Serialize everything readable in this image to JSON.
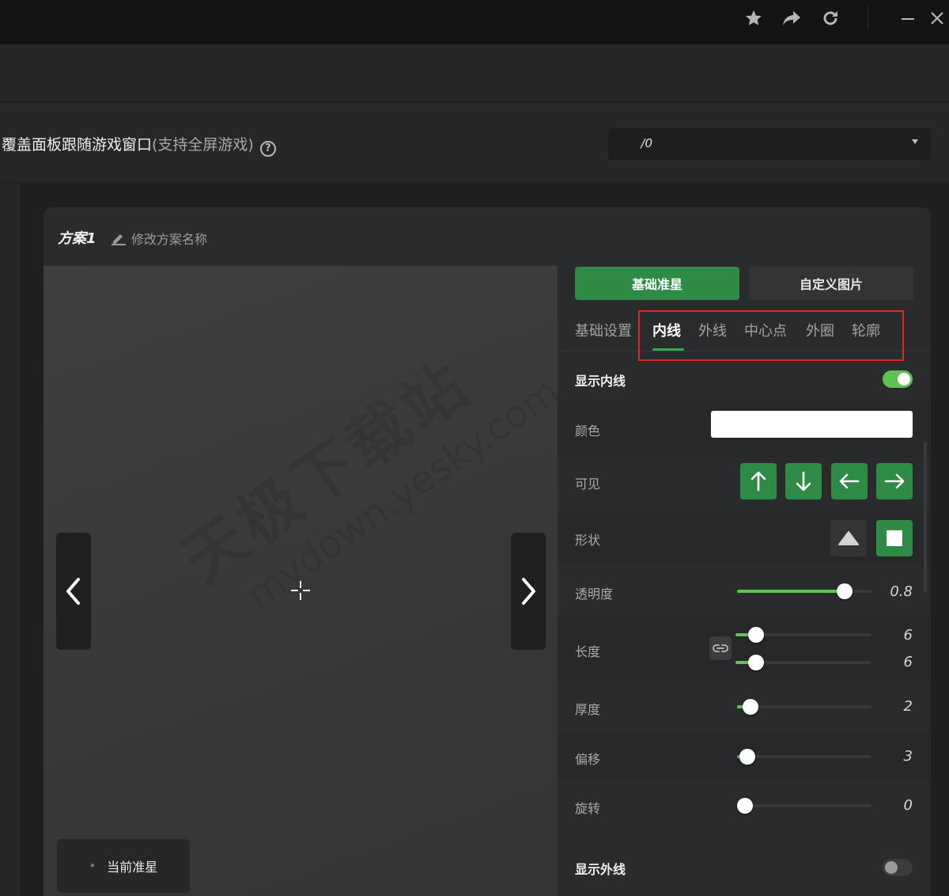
{
  "titlebar": {
    "icons": [
      "star-icon",
      "share-icon",
      "refresh-icon",
      "minimize-icon",
      "close-icon"
    ]
  },
  "setting": {
    "label": "覆盖面板跟随游戏窗口",
    "sublabel": "(支持全屏游戏)",
    "help": "?",
    "select_value": "/0"
  },
  "scheme": {
    "title": "方案1",
    "rename_label": "修改方案名称"
  },
  "preview": {
    "watermark_cn": "天极下载站",
    "watermark_en": "mydown.yesky.com",
    "current_label": "当前准星"
  },
  "type_buttons": {
    "basic": "基础准星",
    "custom": "自定义图片"
  },
  "tabs": [
    "基础设置",
    "内线",
    "外线",
    "中心点",
    "外圈",
    "轮廓"
  ],
  "active_tab": "内线",
  "settings": {
    "show_inner_label": "显示内线",
    "show_inner_on": true,
    "color_label": "颜色",
    "color_value": "#ffffff",
    "visible_label": "可见",
    "visible_dirs": [
      "arrow-up-icon",
      "arrow-down-icon",
      "arrow-left-icon",
      "arrow-right-icon"
    ],
    "shape_label": "形状",
    "shape_selected": "square",
    "opacity_label": "透明度",
    "opacity_value": 0.8,
    "opacity_display": "0.8",
    "length_label": "长度",
    "length_values": [
      6,
      6
    ],
    "length_display": [
      "6",
      "6"
    ],
    "length_max": 40,
    "thickness_label": "厚度",
    "thickness_value": 2,
    "thickness_display": "2",
    "thickness_max": 20,
    "offset_label": "偏移",
    "offset_value": 3,
    "offset_display": "3",
    "offset_max": 40,
    "rotation_label": "旋转",
    "rotation_value": 0,
    "rotation_display": "0",
    "rotation_max": 360,
    "show_outer_label": "显示外线",
    "show_outer_on": false
  },
  "colors": {
    "accent_green": "#2e8b46",
    "slider_green": "#62c455",
    "highlight_red": "#e02424"
  }
}
